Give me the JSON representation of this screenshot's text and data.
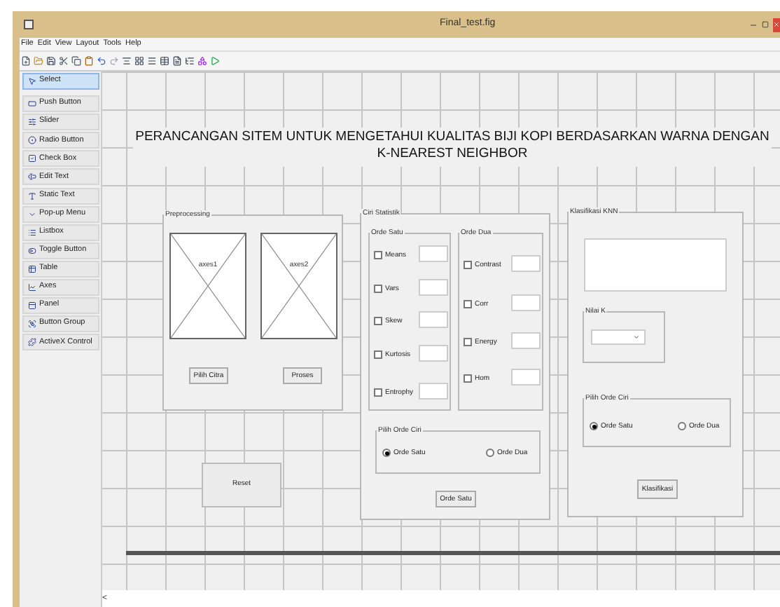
{
  "window": {
    "title": "Final_test.fig"
  },
  "menu": [
    "File",
    "Edit",
    "View",
    "Layout",
    "Tools",
    "Help"
  ],
  "palette": [
    {
      "label": "Select",
      "selected": true
    },
    {
      "label": "Push Button",
      "selected": false
    },
    {
      "label": "Slider",
      "selected": false
    },
    {
      "label": "Radio Button",
      "selected": false
    },
    {
      "label": "Check Box",
      "selected": false
    },
    {
      "label": "Edit Text",
      "selected": false
    },
    {
      "label": "Static Text",
      "selected": false
    },
    {
      "label": "Pop-up Menu",
      "selected": false
    },
    {
      "label": "Listbox",
      "selected": false
    },
    {
      "label": "Toggle Button",
      "selected": false
    },
    {
      "label": "Table",
      "selected": false
    },
    {
      "label": "Axes",
      "selected": false
    },
    {
      "label": "Panel",
      "selected": false
    },
    {
      "label": "Button Group",
      "selected": false
    },
    {
      "label": "ActiveX Control",
      "selected": false
    }
  ],
  "figure": {
    "heading": "PERANCANGAN SITEM UNTUK MENGETAHUI KUALITAS BIJI KOPI BERDASARKAN WARNA DENGAN K-NEAREST NEIGHBOR",
    "preprocessing": {
      "title": "Preprocessing",
      "axes": [
        "axes1",
        "axes2"
      ],
      "buttons": [
        "Pilih Citra",
        "Proses"
      ]
    },
    "reset_button": "Reset",
    "ciri_statistik": {
      "title": "Ciri Statistik",
      "orde_satu": {
        "title": "Orde Satu",
        "items": [
          {
            "label": "Means",
            "checked": false
          },
          {
            "label": "Vars",
            "checked": false
          },
          {
            "label": "Skew",
            "checked": false
          },
          {
            "label": "Kurtosis",
            "checked": false
          },
          {
            "label": "Entrophy",
            "checked": false
          }
        ]
      },
      "orde_dua": {
        "title": "Orde Dua",
        "items": [
          {
            "label": "Contrast",
            "checked": false
          },
          {
            "label": "Corr",
            "checked": false
          },
          {
            "label": "Energy",
            "checked": false
          },
          {
            "label": "Hom",
            "checked": false
          }
        ]
      },
      "pilih_orde_ciri": {
        "title": "Pilih Orde Ciri",
        "options": [
          {
            "label": "Orde Satu",
            "selected": true
          },
          {
            "label": "Orde Dua",
            "selected": false
          }
        ]
      },
      "button": "Orde Satu"
    },
    "klasifikasi_knn": {
      "title": "Klasifikasi KNN",
      "nilai_k": {
        "title": "Nilai K"
      },
      "pilih_orde_ciri": {
        "title": "Pilih Orde Ciri",
        "options": [
          {
            "label": "Orde Satu",
            "selected": true
          },
          {
            "label": "Orde Dua",
            "selected": false
          }
        ]
      },
      "button": "Klasifikasi"
    }
  },
  "scroll_arrow": "<"
}
